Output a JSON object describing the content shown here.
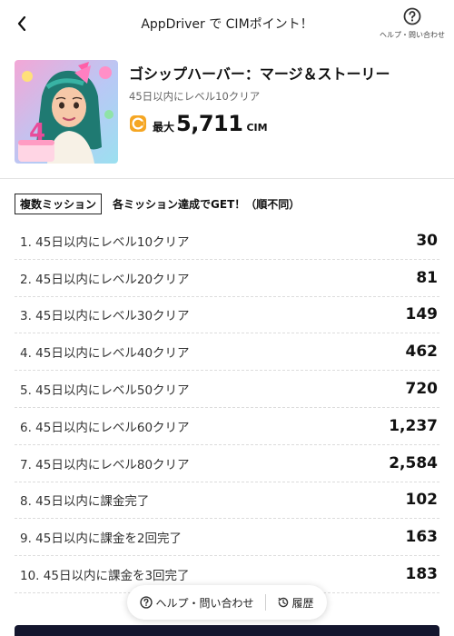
{
  "header": {
    "title": "AppDriver で CIMポイント！",
    "help_label": "ヘルプ・問い合わせ"
  },
  "app": {
    "name": "ゴシップハーバー：マージ＆ストーリー",
    "subtitle": "45日以内にレベル10クリア",
    "reward_prefix": "最大",
    "reward_value": "5,711",
    "reward_unit": "CIM",
    "icon": "app-icon-girl-with-birthday-cake"
  },
  "missions": {
    "badge": "複数ミッション",
    "note": "各ミッション達成でGET！（順不同）",
    "items": [
      {
        "label": "1. 45日以内にレベル10クリア",
        "points": "30"
      },
      {
        "label": "2. 45日以内にレベル20クリア",
        "points": "81"
      },
      {
        "label": "3. 45日以内にレベル30クリア",
        "points": "149"
      },
      {
        "label": "4. 45日以内にレベル40クリア",
        "points": "462"
      },
      {
        "label": "5. 45日以内にレベル50クリア",
        "points": "720"
      },
      {
        "label": "6. 45日以内にレベル60クリア",
        "points": "1,237"
      },
      {
        "label": "7. 45日以内にレベル80クリア",
        "points": "2,584"
      },
      {
        "label": "8. 45日以内に課金完了",
        "points": "102"
      },
      {
        "label": "9. 45日以内に課金を2回完了",
        "points": "163"
      },
      {
        "label": "10. 45日以内に課金を3回完了",
        "points": "183"
      }
    ]
  },
  "footer": {
    "help_label": "ヘルプ・問い合わせ",
    "history_label": "履歴"
  },
  "colors": {
    "coin": "#f5a623",
    "bottom_bar": "#14162e"
  }
}
